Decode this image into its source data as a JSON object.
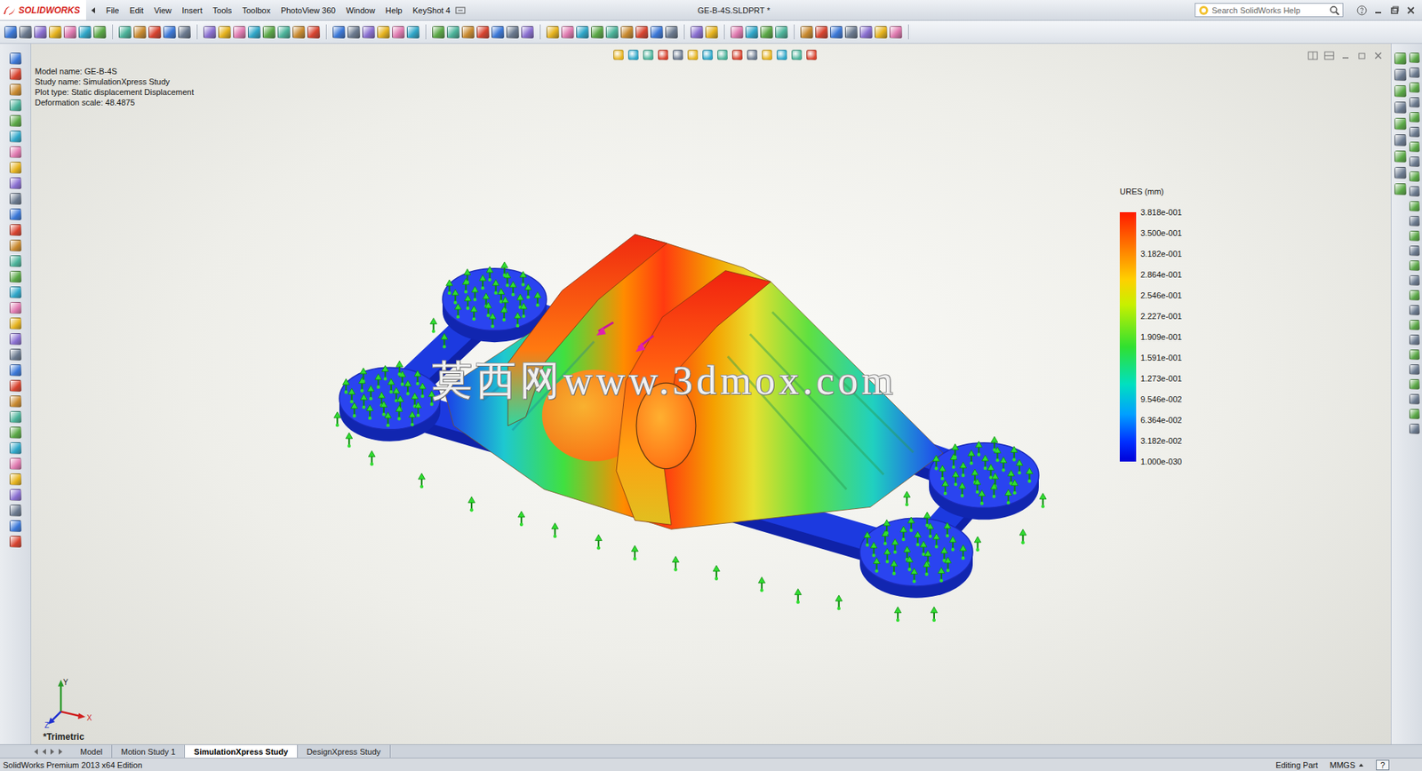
{
  "app": {
    "logo": "SOLIDWORKS",
    "document_title": "GE-B-4S.SLDPRT *"
  },
  "menu": [
    "File",
    "Edit",
    "View",
    "Insert",
    "Tools",
    "Toolbox",
    "PhotoView 360",
    "Window",
    "Help",
    "KeyShot 4"
  ],
  "search": {
    "placeholder": "Search SolidWorks Help"
  },
  "info": [
    "Model name: GE-B-4S",
    "Study name: SimulationXpress Study",
    "Plot type: Static displacement Displacement",
    "Deformation scale: 48.4875"
  ],
  "legend": {
    "title": "URES (mm)",
    "values": [
      "3.818e-001",
      "3.500e-001",
      "3.182e-001",
      "2.864e-001",
      "2.546e-001",
      "2.227e-001",
      "1.909e-001",
      "1.591e-001",
      "1.273e-001",
      "9.546e-002",
      "6.364e-002",
      "3.182e-002",
      "1.000e-030"
    ]
  },
  "watermark": "莫西网www.3dmox.com",
  "triad": {
    "x": "X",
    "y": "Y",
    "z": "Z"
  },
  "view_name": "*Trimetric",
  "tabs": [
    {
      "label": "Model",
      "selected": false
    },
    {
      "label": "Motion Study 1",
      "selected": false
    },
    {
      "label": "SimulationXpress Study",
      "selected": true
    },
    {
      "label": "DesignXpress Study",
      "selected": false
    }
  ],
  "status_bar": {
    "edition": "SolidWorks Premium 2013 x64 Edition",
    "mode": "Editing Part",
    "units": "MMGS",
    "help": "?"
  }
}
